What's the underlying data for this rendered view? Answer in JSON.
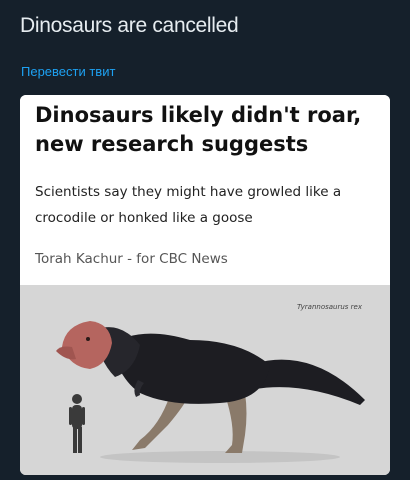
{
  "tweet": {
    "text": "Dinosaurs are cancelled",
    "translate_link": "Перевести твит"
  },
  "card": {
    "headline": "Dinosaurs likely didn't roar, new research suggests",
    "subhead": "Scientists say they might have growled like a crocodile or honked like a goose",
    "byline": "Torah Kachur - for CBC News",
    "image": {
      "species_label": "Tyrannosaurus rex"
    }
  },
  "colors": {
    "background": "#15202b",
    "tweet_text": "#e6ecf0",
    "link": "#1da1f2",
    "card_bg": "#ffffff",
    "image_bg": "#d6d6d6"
  }
}
